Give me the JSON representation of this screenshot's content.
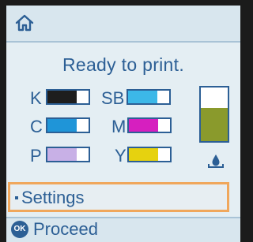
{
  "header": {
    "home_icon": "home-icon"
  },
  "status": {
    "text": "Ready to print."
  },
  "inks": [
    {
      "id": "K",
      "label": "K",
      "color": "#1e1e1e",
      "level": 0.72
    },
    {
      "id": "SB",
      "label": "SB",
      "color": "#3cb8e8",
      "level": 0.72
    },
    {
      "id": "C",
      "label": "C",
      "color": "#1f95d8",
      "level": 0.72
    },
    {
      "id": "M",
      "label": "M",
      "color": "#d61fbf",
      "level": 0.72
    },
    {
      "id": "P",
      "label": "P",
      "color": "#c8b0e6",
      "level": 0.72
    },
    {
      "id": "Y",
      "label": "Y",
      "color": "#e6d20f",
      "level": 0.72
    }
  ],
  "maintenance_box": {
    "color": "#8a9a2c",
    "level": 0.62,
    "icon": "ink-drop-icon"
  },
  "menu": {
    "settings_label": "Settings"
  },
  "footer": {
    "ok_icon_text": "OK",
    "proceed_label": "Proceed"
  }
}
